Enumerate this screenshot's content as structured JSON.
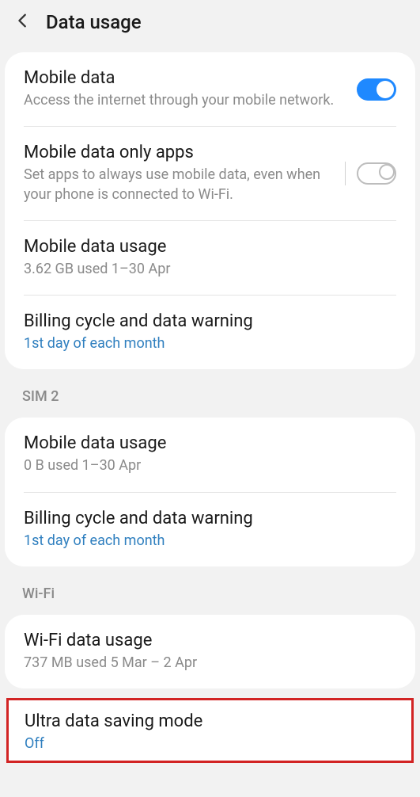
{
  "header": {
    "title": "Data usage"
  },
  "sim1": {
    "mobileData": {
      "title": "Mobile data",
      "sub": "Access the internet through your mobile network."
    },
    "onlyApps": {
      "title": "Mobile data only apps",
      "sub": "Set apps to always use mobile data, even when your phone is connected to Wi-Fi."
    },
    "usage": {
      "title": "Mobile data usage",
      "sub": "3.62 GB used 1–30 Apr"
    },
    "billing": {
      "title": "Billing cycle and data warning",
      "sub": "1st day of each month"
    }
  },
  "sim2": {
    "label": "SIM 2",
    "usage": {
      "title": "Mobile data usage",
      "sub": "0 B used 1–30 Apr"
    },
    "billing": {
      "title": "Billing cycle and data warning",
      "sub": "1st day of each month"
    }
  },
  "wifi": {
    "label": "Wi-Fi",
    "usage": {
      "title": "Wi-Fi data usage",
      "sub": "737 MB used 5 Mar – 2 Apr"
    }
  },
  "ultra": {
    "title": "Ultra data saving mode",
    "sub": "Off"
  }
}
